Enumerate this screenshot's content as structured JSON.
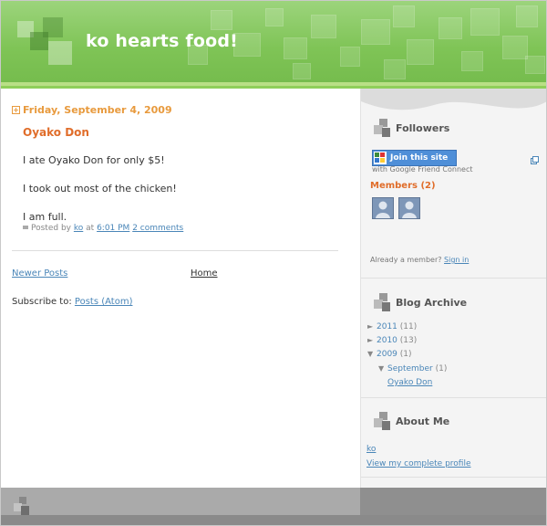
{
  "header": {
    "title": "ko hearts food!"
  },
  "post": {
    "date": "Friday, September 4, 2009",
    "title": "Oyako Don",
    "lines": [
      "I ate Oyako Don for only $5!",
      "I took out most of the chicken!",
      "I am full."
    ],
    "footer": {
      "posted_by": "Posted by",
      "author": "ko",
      "at": "at",
      "time": "6:01 PM",
      "comments": "2 comments"
    }
  },
  "nav": {
    "newer_posts": "Newer Posts",
    "home": "Home",
    "subscribe_label": "Subscribe to:",
    "subscribe_link": "Posts (Atom)"
  },
  "sidebar": {
    "followers": {
      "title": "Followers",
      "join_button": "Join this site",
      "gfc_text": "with Google Friend Connect",
      "members_title": "Members (2)",
      "already_member": "Already a member?",
      "sign_in": "Sign in"
    },
    "archive": {
      "title": "Blog Archive",
      "items": [
        {
          "toggle": "►",
          "label": "2011",
          "count": "(11)"
        },
        {
          "toggle": "►",
          "label": "2010",
          "count": "(13)"
        },
        {
          "toggle": "▼",
          "label": "2009",
          "count": "(1)"
        },
        {
          "toggle": "▼",
          "label": "September",
          "count": "(1)"
        },
        {
          "toggle": "",
          "label": "Oyako Don",
          "count": ""
        }
      ]
    },
    "about": {
      "title": "About Me",
      "name": "ko",
      "profile_link": "View my complete profile"
    }
  },
  "colors": {
    "header_green": "#7fc456",
    "date_orange": "#e89a3d",
    "title_orange": "#e06d2a",
    "link_blue": "#4a86b8",
    "button_blue": "#4f8fd8"
  },
  "icons": [
    "squares-logo-icon",
    "widget-squares-icon",
    "google-friend-connect-icon",
    "expand-icon",
    "avatar-icon",
    "triangle-icon"
  ]
}
